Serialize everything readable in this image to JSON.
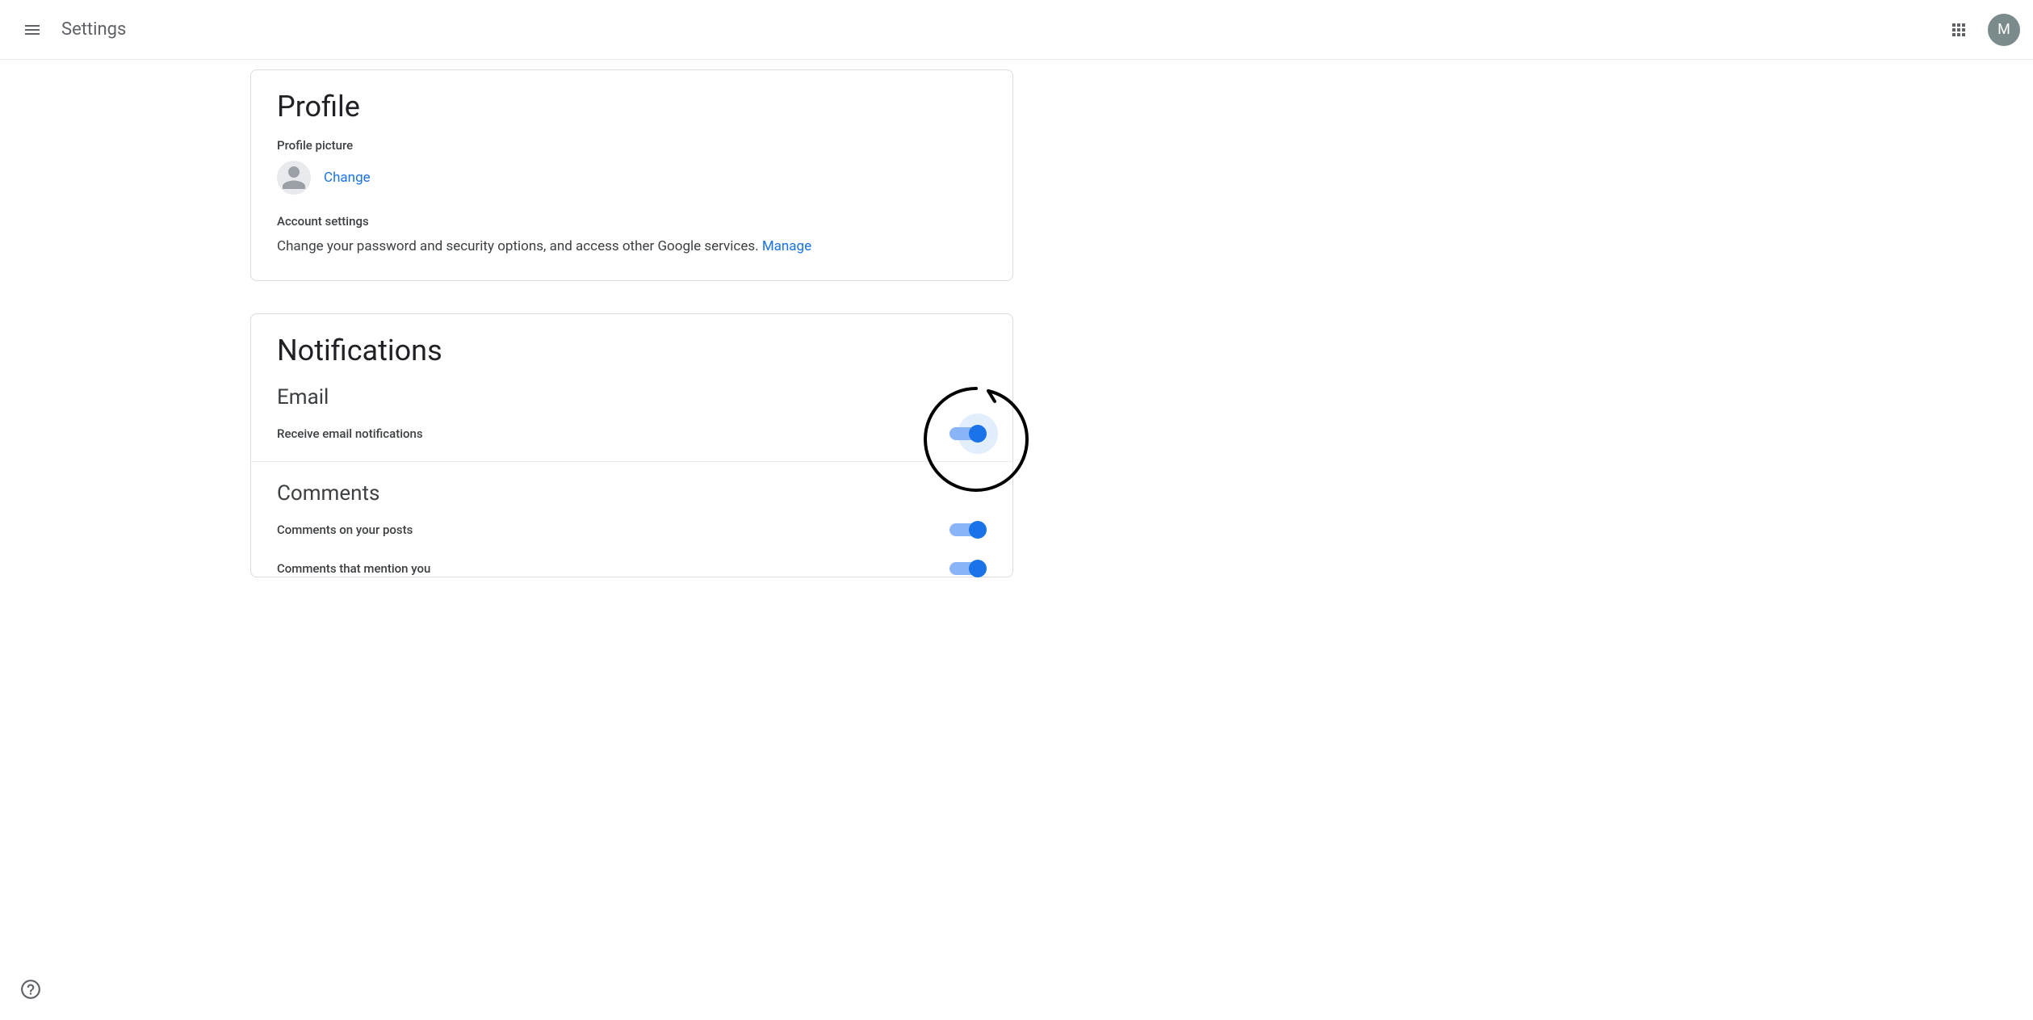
{
  "header": {
    "title": "Settings",
    "avatar_initial": "M"
  },
  "profile": {
    "title": "Profile",
    "picture_label": "Profile picture",
    "change_link": "Change",
    "account_label": "Account settings",
    "account_desc": "Change your password and security options, and access other Google services. ",
    "manage_link": "Manage"
  },
  "notifications": {
    "title": "Notifications",
    "email": {
      "title": "Email",
      "receive_label": "Receive email notifications",
      "receive_on": true
    },
    "comments": {
      "title": "Comments",
      "on_posts_label": "Comments on your posts",
      "on_posts_on": true,
      "mention_label": "Comments that mention you",
      "mention_on": true
    }
  }
}
